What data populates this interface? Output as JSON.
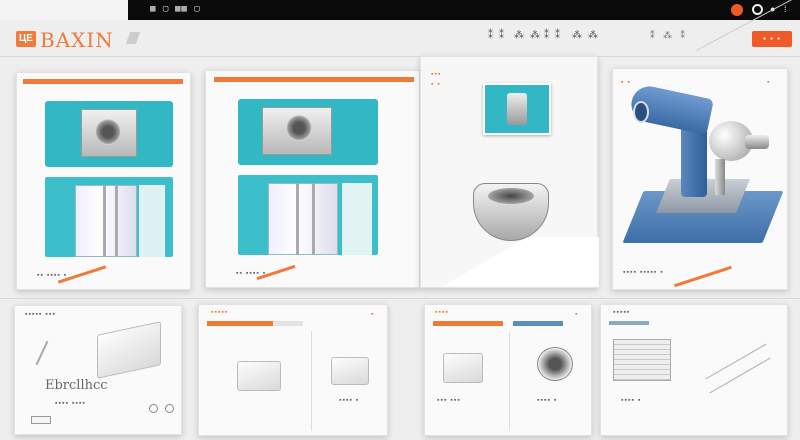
{
  "topbar": {
    "left_glyphs": "▦ ▢",
    "mid_glyphs": "▦▦ ▢",
    "menu_glyph": "⁞"
  },
  "header": {
    "logo_mark": "ЦE",
    "logo_text": "BAXIN",
    "nav_items": [
      "⁑ ⁑",
      "⁂ ⁂",
      "⁑ ⁑",
      "⁂ ⁂"
    ],
    "right_glyphs": "⁑ ⁂ ⁑",
    "cta_label": "▪ ▪ ▪"
  },
  "cards": {
    "card1_caption": "▪▪ ▪▪▪▪ ▪",
    "card2_caption": "▪▪ ▪▪▪▪ ▪",
    "card4_caption": "▪▪▪▪ ▪▪▪▪▪ ▪",
    "card5_top": "▪▪▪▪▪ ▪▪▪",
    "card5_label": "Ebrcllhcc",
    "card5_sub": "▪▪▪▪ ▪▪▪▪",
    "card6_top": "▪▪▪▪▪",
    "card6_caption": "▪▪▪▪ ▪",
    "card7_caption": "▪▪▪▪ ▪",
    "card8_caption": "▪▪▪ ▪▪▪",
    "card9_caption": "▪▪▪▪ ▪",
    "card10_top": "▪▪▪▪▪",
    "card10_caption": "▪▪▪▪ ▪"
  },
  "colors": {
    "accent": "#f07a3a",
    "teal": "#32b7c4",
    "blue": "#5b8fb8"
  }
}
